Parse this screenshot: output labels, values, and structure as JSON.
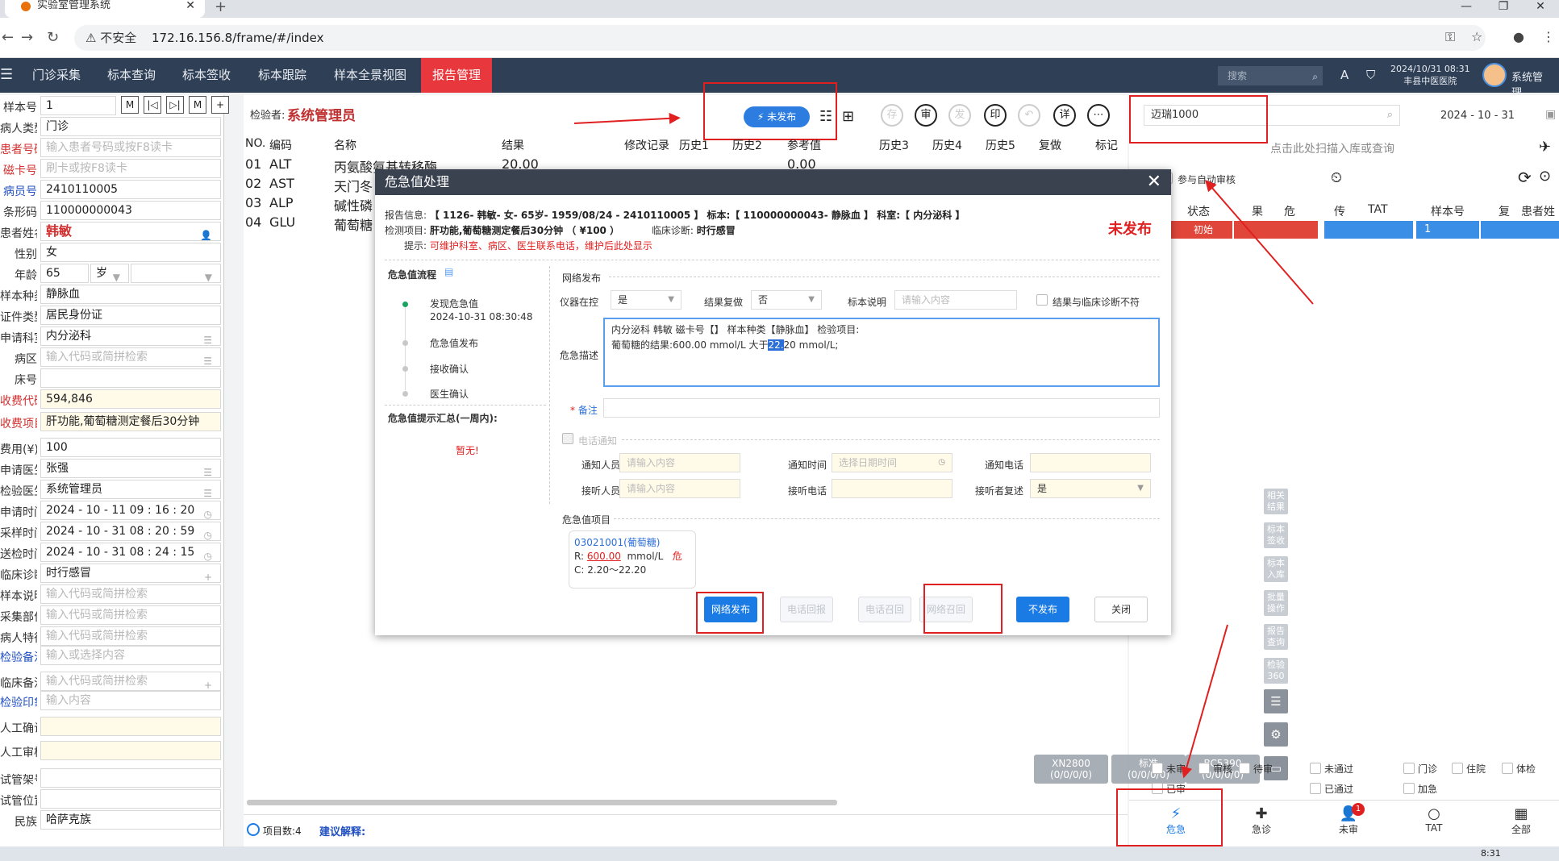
{
  "browser": {
    "tab_title": "实验室管理系统",
    "security": "不安全",
    "url": "172.16.156.8/frame/#/index"
  },
  "nav": {
    "items": [
      "门诊采集",
      "标本查询",
      "标本签收",
      "标本跟踪",
      "样本全景视图",
      "报告管理"
    ],
    "active": "报告管理",
    "search_placeholder": "搜索",
    "datetime": "2024/10/31 08:31",
    "hospital": "丰县中医医院",
    "user": "系统管理..."
  },
  "left": {
    "fields": [
      {
        "label": "样本号",
        "value": "1",
        "style": "sample"
      },
      {
        "label": "病人类型",
        "value": "门诊"
      },
      {
        "label": "患者号码",
        "value": "输入患者号码或按F8读卡",
        "ph": true,
        "lblc": "red"
      },
      {
        "label": "磁卡号",
        "value": "刷卡或按F8读卡",
        "ph": true,
        "lblc": "red"
      },
      {
        "label": "病员号",
        "value": "2410110005",
        "lblc": "blue"
      },
      {
        "label": "条形码",
        "value": "110000000043"
      },
      {
        "label": "患者姓名",
        "value": "韩敏",
        "style": "name"
      },
      {
        "label": "性别",
        "value": "女"
      },
      {
        "label": "年龄",
        "value": "65",
        "style": "age"
      },
      {
        "label": "样本种类",
        "value": "静脉血"
      },
      {
        "label": "证件类型",
        "value": "居民身份证"
      },
      {
        "label": "申请科室",
        "value": "内分泌科"
      },
      {
        "label": "病区",
        "value": "输入代码或简拼检索",
        "ph": true
      },
      {
        "label": "床号",
        "value": ""
      },
      {
        "label": "收费代码",
        "value": "594,846",
        "lblc": "red",
        "yellow": true
      },
      {
        "label": "收费项目",
        "value": "肝功能,葡萄糖测定餐后30分钟",
        "lblc": "red",
        "yellow": true
      },
      {
        "label": "费用(¥)",
        "value": "100"
      },
      {
        "label": "申请医生",
        "value": "张强"
      },
      {
        "label": "检验医生",
        "value": "系统管理员"
      },
      {
        "label": "申请时间",
        "value": "2024 - 10 - 11  09 : 16 : 20"
      },
      {
        "label": "采样时间",
        "value": "2024 - 10 - 31  08 : 20 : 59"
      },
      {
        "label": "送检时间",
        "value": "2024 - 10 - 31  08 : 24 : 15"
      },
      {
        "label": "临床诊断",
        "value": "时行感冒"
      },
      {
        "label": "样本说明",
        "value": "输入代码或简拼检索",
        "ph": true
      },
      {
        "label": "采集部位",
        "value": "输入代码或简拼检索",
        "ph": true
      },
      {
        "label": "病人特征",
        "value": "输入代码或简拼检索",
        "ph": true
      },
      {
        "label": "检验备注",
        "value": "输入或选择内容",
        "ph": true,
        "lblc": "blue"
      },
      {
        "label": "临床备注",
        "value": "输入代码或简拼检索",
        "ph": true
      },
      {
        "label": "检验印象",
        "value": "输入内容",
        "ph": true,
        "lblc": "blue"
      },
      {
        "label": "人工确认",
        "value": "",
        "yellow": true
      },
      {
        "label": "人工审核",
        "value": "",
        "yellow": true
      },
      {
        "label": "试管架号",
        "value": ""
      },
      {
        "label": "试管位置",
        "value": ""
      },
      {
        "label": "民族",
        "value": "哈萨克族"
      }
    ],
    "age_unit": "岁"
  },
  "middle": {
    "inspector_label": "检验者:",
    "inspector": "系统管理员",
    "unpublished_btn": "未发布",
    "toolbar_circles": [
      "存",
      "审",
      "发",
      "印",
      "↶",
      "详",
      "⋯"
    ],
    "grid_headers": [
      "NO.",
      "编码",
      "名称",
      "结果",
      "修改记录",
      "历史1",
      "历史2",
      "参考值",
      "历史3",
      "历史4",
      "历史5",
      "复做",
      "标记"
    ],
    "rows": [
      {
        "no": "01",
        "code": "ALT",
        "name": "丙氨酸氨基转移酶",
        "result": "20.00",
        "ref": "0.00～31.00 U"
      },
      {
        "no": "02",
        "code": "AST",
        "name": "天门冬"
      },
      {
        "no": "03",
        "code": "ALP",
        "name": "碱性磷"
      },
      {
        "no": "04",
        "code": "GLU",
        "name": "葡萄糖"
      }
    ],
    "item_count": "项目数:4",
    "suggest": "建议解释:"
  },
  "modal": {
    "title": "危急值处理",
    "report_label": "报告信息:",
    "report_info": "【 1126- 韩敏- 女- 65岁- 1959/08/24 - 2410110005 】 标本:【 110000000043- 静脉血 】 科室:【 内分泌科 】",
    "test_label": "检测项目:",
    "test_items": "肝功能,葡萄糖测定餐后30分钟 （ ¥100 ）",
    "diag_label": "临床诊断:",
    "diag": "时行感冒",
    "hint_label": "提示:",
    "hint": "可维护科室、病区、医生联系电话，维护后此处显示",
    "status": "未发布",
    "flow_title": "危急值流程",
    "flow": [
      {
        "name": "发现危急值",
        "time": "2024-10-31 08:30:48"
      },
      {
        "name": "危急值发布"
      },
      {
        "name": "接收确认"
      },
      {
        "name": "医生确认"
      }
    ],
    "summary_title": "危急值提示汇总(一周内):",
    "summary_empty": "暂无!",
    "net_publish_title": "网络发布",
    "instrument_label": "仪器在控",
    "instrument_value": "是",
    "retest_label": "结果复做",
    "retest_value": "否",
    "sample_note_label": "标本说明",
    "sample_note_ph": "请输入内容",
    "mismatch_label": "结果与临床诊断不符",
    "desc_label": "危急描述",
    "desc_line1": "内分泌科 韩敏 磁卡号【】 样本种类【静脉血】 检验项目:",
    "desc_line2_a": "葡萄糖的结果:600.00 mmol/L 大于",
    "desc_line2_hl": "22.",
    "desc_line2_b": "20 mmol/L;",
    "remark_label": "备注",
    "phone_notify_label": "电话通知",
    "notify_person_label": "通知人员",
    "notify_person_ph": "请输入内容",
    "notify_time_label": "通知时间",
    "notify_time_ph": "选择日期时间",
    "notify_phone_label": "通知电话",
    "receiver_label": "接听人员",
    "receiver_ph": "请输入内容",
    "receiver_phone_label": "接听电话",
    "repeat_label": "接听者复述",
    "repeat_value": "是",
    "crit_items_title": "危急值项目",
    "crit_card": {
      "code": "03021001(葡萄糖)",
      "r_label": "R:",
      "r_value": "600.00",
      "unit": "mmol/L",
      "flag": "危",
      "c_range": "C: 2.20～22.20"
    },
    "buttons": [
      "网络发布",
      "电话回报",
      "电话召回",
      "网络召回",
      "不发布",
      "关闭"
    ]
  },
  "right": {
    "search_value": "迈瑞1000",
    "date": "2024 - 10 - 31",
    "scan_hint": "点击此处扫描入库或查询",
    "auto_audit": "参与自动审核",
    "headers": [
      "状态",
      "果",
      "危",
      "传",
      "TAT",
      "样本号",
      "复",
      "患者姓"
    ],
    "row": {
      "status": "初始",
      "sample": "1"
    },
    "side_buttons": [
      "相关结果",
      "标本签收",
      "标本入库",
      "批量操作",
      "报告查询",
      "检验360"
    ],
    "devices": [
      {
        "name": "XN2800",
        "count": "(0/0/0/0)"
      },
      {
        "name": "标准",
        "count": "(0/0/0/0)"
      },
      {
        "name": "BC5390",
        "count": "(0/0/0/0)"
      }
    ],
    "filters": [
      "未审",
      "审核",
      "待审",
      "已审",
      "未通过",
      "已通过",
      "门诊",
      "住院",
      "体检",
      "加急"
    ],
    "bottom_nav": [
      {
        "label": "危急",
        "icon": "⚡"
      },
      {
        "label": "急诊",
        "icon": "✚"
      },
      {
        "label": "未审",
        "icon": "👤",
        "badge": "1"
      },
      {
        "label": "TAT",
        "icon": "○"
      },
      {
        "label": "全部",
        "icon": "▦"
      }
    ]
  },
  "taskbar": {
    "time": "8:31"
  }
}
